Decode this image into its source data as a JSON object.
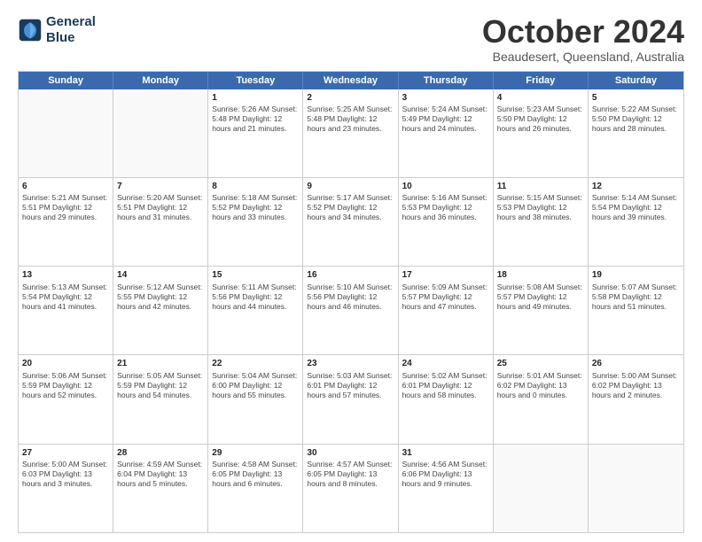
{
  "logo": {
    "line1": "General",
    "line2": "Blue"
  },
  "title": "October 2024",
  "subtitle": "Beaudesert, Queensland, Australia",
  "header_days": [
    "Sunday",
    "Monday",
    "Tuesday",
    "Wednesday",
    "Thursday",
    "Friday",
    "Saturday"
  ],
  "weeks": [
    [
      {
        "day": "",
        "content": ""
      },
      {
        "day": "",
        "content": ""
      },
      {
        "day": "1",
        "content": "Sunrise: 5:26 AM\nSunset: 5:48 PM\nDaylight: 12 hours\nand 21 minutes."
      },
      {
        "day": "2",
        "content": "Sunrise: 5:25 AM\nSunset: 5:48 PM\nDaylight: 12 hours\nand 23 minutes."
      },
      {
        "day": "3",
        "content": "Sunrise: 5:24 AM\nSunset: 5:49 PM\nDaylight: 12 hours\nand 24 minutes."
      },
      {
        "day": "4",
        "content": "Sunrise: 5:23 AM\nSunset: 5:50 PM\nDaylight: 12 hours\nand 26 minutes."
      },
      {
        "day": "5",
        "content": "Sunrise: 5:22 AM\nSunset: 5:50 PM\nDaylight: 12 hours\nand 28 minutes."
      }
    ],
    [
      {
        "day": "6",
        "content": "Sunrise: 5:21 AM\nSunset: 5:51 PM\nDaylight: 12 hours\nand 29 minutes."
      },
      {
        "day": "7",
        "content": "Sunrise: 5:20 AM\nSunset: 5:51 PM\nDaylight: 12 hours\nand 31 minutes."
      },
      {
        "day": "8",
        "content": "Sunrise: 5:18 AM\nSunset: 5:52 PM\nDaylight: 12 hours\nand 33 minutes."
      },
      {
        "day": "9",
        "content": "Sunrise: 5:17 AM\nSunset: 5:52 PM\nDaylight: 12 hours\nand 34 minutes."
      },
      {
        "day": "10",
        "content": "Sunrise: 5:16 AM\nSunset: 5:53 PM\nDaylight: 12 hours\nand 36 minutes."
      },
      {
        "day": "11",
        "content": "Sunrise: 5:15 AM\nSunset: 5:53 PM\nDaylight: 12 hours\nand 38 minutes."
      },
      {
        "day": "12",
        "content": "Sunrise: 5:14 AM\nSunset: 5:54 PM\nDaylight: 12 hours\nand 39 minutes."
      }
    ],
    [
      {
        "day": "13",
        "content": "Sunrise: 5:13 AM\nSunset: 5:54 PM\nDaylight: 12 hours\nand 41 minutes."
      },
      {
        "day": "14",
        "content": "Sunrise: 5:12 AM\nSunset: 5:55 PM\nDaylight: 12 hours\nand 42 minutes."
      },
      {
        "day": "15",
        "content": "Sunrise: 5:11 AM\nSunset: 5:56 PM\nDaylight: 12 hours\nand 44 minutes."
      },
      {
        "day": "16",
        "content": "Sunrise: 5:10 AM\nSunset: 5:56 PM\nDaylight: 12 hours\nand 46 minutes."
      },
      {
        "day": "17",
        "content": "Sunrise: 5:09 AM\nSunset: 5:57 PM\nDaylight: 12 hours\nand 47 minutes."
      },
      {
        "day": "18",
        "content": "Sunrise: 5:08 AM\nSunset: 5:57 PM\nDaylight: 12 hours\nand 49 minutes."
      },
      {
        "day": "19",
        "content": "Sunrise: 5:07 AM\nSunset: 5:58 PM\nDaylight: 12 hours\nand 51 minutes."
      }
    ],
    [
      {
        "day": "20",
        "content": "Sunrise: 5:06 AM\nSunset: 5:59 PM\nDaylight: 12 hours\nand 52 minutes."
      },
      {
        "day": "21",
        "content": "Sunrise: 5:05 AM\nSunset: 5:59 PM\nDaylight: 12 hours\nand 54 minutes."
      },
      {
        "day": "22",
        "content": "Sunrise: 5:04 AM\nSunset: 6:00 PM\nDaylight: 12 hours\nand 55 minutes."
      },
      {
        "day": "23",
        "content": "Sunrise: 5:03 AM\nSunset: 6:01 PM\nDaylight: 12 hours\nand 57 minutes."
      },
      {
        "day": "24",
        "content": "Sunrise: 5:02 AM\nSunset: 6:01 PM\nDaylight: 12 hours\nand 58 minutes."
      },
      {
        "day": "25",
        "content": "Sunrise: 5:01 AM\nSunset: 6:02 PM\nDaylight: 13 hours\nand 0 minutes."
      },
      {
        "day": "26",
        "content": "Sunrise: 5:00 AM\nSunset: 6:02 PM\nDaylight: 13 hours\nand 2 minutes."
      }
    ],
    [
      {
        "day": "27",
        "content": "Sunrise: 5:00 AM\nSunset: 6:03 PM\nDaylight: 13 hours\nand 3 minutes."
      },
      {
        "day": "28",
        "content": "Sunrise: 4:59 AM\nSunset: 6:04 PM\nDaylight: 13 hours\nand 5 minutes."
      },
      {
        "day": "29",
        "content": "Sunrise: 4:58 AM\nSunset: 6:05 PM\nDaylight: 13 hours\nand 6 minutes."
      },
      {
        "day": "30",
        "content": "Sunrise: 4:57 AM\nSunset: 6:05 PM\nDaylight: 13 hours\nand 8 minutes."
      },
      {
        "day": "31",
        "content": "Sunrise: 4:56 AM\nSunset: 6:06 PM\nDaylight: 13 hours\nand 9 minutes."
      },
      {
        "day": "",
        "content": ""
      },
      {
        "day": "",
        "content": ""
      }
    ]
  ]
}
